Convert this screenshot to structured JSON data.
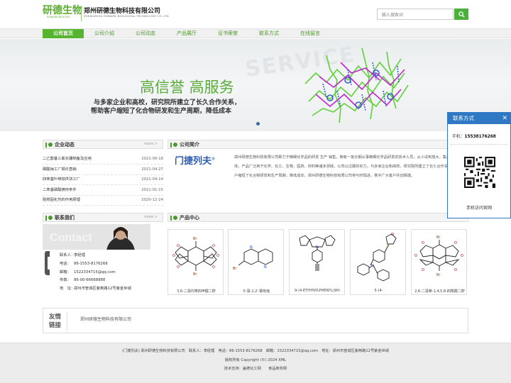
{
  "header": {
    "logo_text": "研德生物",
    "logo_sub": "EDWARD BIOLOGY",
    "company_cn": "郑州研德生物科技有限公司",
    "company_en": "ZHENGZHOU EDWARD BIOLOGICAL TECHNOLOGY CO. LTD",
    "search_placeholder": "输入搜索词"
  },
  "nav": [
    "公司首页",
    "公司介绍",
    "公司动态",
    "产品展厅",
    "证书荣誉",
    "联系方式",
    "在线留言"
  ],
  "banner": {
    "bg_text": "SERVICE",
    "title": "高信誉 高服务",
    "line1": "与多家企业和高校，研究院所建立了长久合作关系，",
    "line2": "帮助客户缩短了化合物研发和生产周期，降低成本"
  },
  "news": {
    "title": "企业动态",
    "more": "more >",
    "items": [
      {
        "title": "二乙醇基三氟化硼制备及应用",
        "date": "2021-06-18"
      },
      {
        "title": "磷酸钠工厂报价直销",
        "date": "2021-04-27"
      },
      {
        "title": "四苯基卟啉铁供货工厂",
        "date": "2021-04-14"
      },
      {
        "title": "二苯基磷酸镁存条件",
        "date": "2021-01-15"
      },
      {
        "title": "阻燃固化剂的作用原理",
        "date": "2020-12-24"
      }
    ]
  },
  "about": {
    "title": "公司简介",
    "logo": "门捷列夫",
    "text": "郑州研德生物科技有限公司致力于精细化学品的研发 生产 销售，拥有一批长期从事精细化学品研发的技术人员，从小试到放大，集产学研为一体，产品广泛用于化学、化工、生物、医药、材料等诸多领域，公司以过硬的实力，与多家企业和高校，研究院所建立了长久合作关系，帮助客户缩短了化合物研发和生产周期，降低成本，郑州研德生物科技有限公司将与时俱进，携手广大客户共创辉煌。"
  },
  "contact": {
    "title": "联系我们",
    "more": "more >",
    "person_label": "联系人：",
    "person": "李经理",
    "phone_label": "电话：",
    "phone": "86-1553-8176268",
    "email_label": "邮箱：",
    "email": "1522334715@qq.com",
    "fax_label": "传真：",
    "fax": "86-00-66668888",
    "addr_label": "地　址：",
    "addr": "郑州市管城区紫荆路12号紫金世城"
  },
  "products": {
    "title": "产品中心",
    "more": "more >",
    "items": [
      {
        "name": "3,6-二溴均苯四甲酸二酐"
      },
      {
        "name": "5-溴-2,2'-联吡啶"
      },
      {
        "name": "9-(4-ETHYNYLPHENYL)9H-"
      },
      {
        "name": "5-(4-"
      },
      {
        "name": "2,6-二溴萘-1,4,5,8-四羧酸二酐"
      }
    ]
  },
  "links": {
    "title_1": "友情",
    "title_2": "链接",
    "item": "郑州研德生物科技有限公司"
  },
  "footer": {
    "line1": "(门捷列夫) 郑州研德生物科技有限公司　联系人：李经理　电话：86-1553-8176268　邮箱：1522334715@qq.com　地址：郑州市管城区紫荆路12号紫金世城",
    "line2": "版权所有 Copyright (©) 2024 XML",
    "line3": "技术支持：盖德化工网　　食品商务网"
  },
  "float": {
    "title": "联系方式",
    "phone_label": "手机：",
    "phone": "15538176268",
    "caption": "手机访问官网"
  },
  "colors": {
    "brand_green": "#5bac2e",
    "nav_active": "#56b430",
    "float_blue": "#2f78c4"
  }
}
